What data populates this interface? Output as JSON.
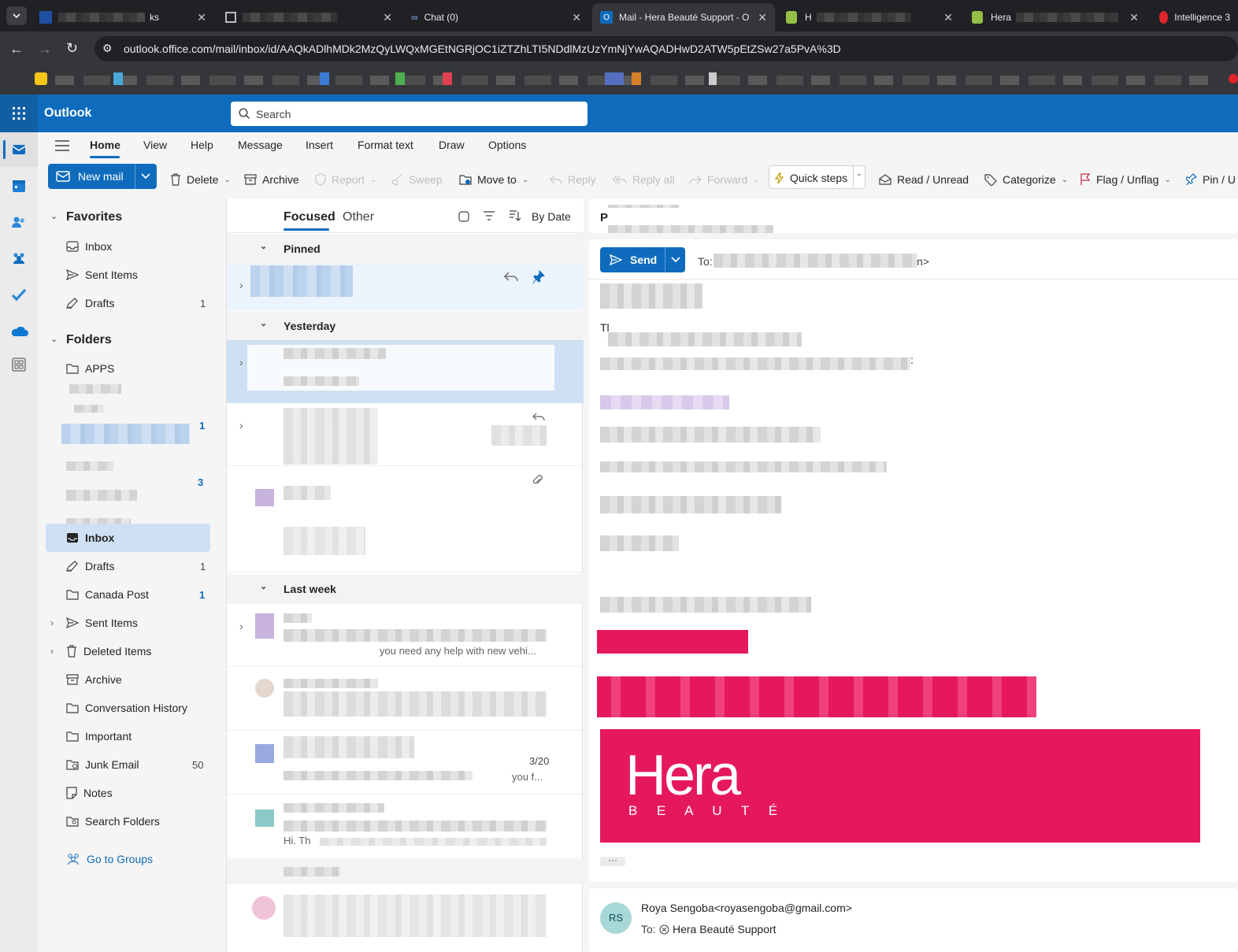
{
  "browser": {
    "tabs": [
      {
        "label": "ks",
        "active": false
      },
      {
        "label": "",
        "active": false
      },
      {
        "label": "Chat (0)",
        "active": false
      },
      {
        "label": "Mail - Hera Beauté Support - O",
        "active": true
      },
      {
        "label": "H",
        "active": false
      },
      {
        "label": "Hera",
        "active": false
      },
      {
        "label": "Intelligence 3",
        "active": false
      }
    ],
    "url": "outlook.office.com/mail/inbox/id/AAQkADlhMDk2MzQyLWQxMGEtNGRjOC1iZTZhLTI5NDdlMzUzYmNjYwAQADHwD2ATW5pEtZSw27a5PvA%3D"
  },
  "header": {
    "app_name": "Outlook",
    "search_placeholder": "Search"
  },
  "ribbon": {
    "tabs": [
      "Home",
      "View",
      "Help",
      "Message",
      "Insert",
      "Format text",
      "Draw",
      "Options"
    ],
    "active_tab": "Home",
    "commands": {
      "new_mail": "New mail",
      "delete": "Delete",
      "archive": "Archive",
      "report": "Report",
      "sweep": "Sweep",
      "move_to": "Move to",
      "reply": "Reply",
      "reply_all": "Reply all",
      "forward": "Forward",
      "quick_steps": "Quick steps",
      "read_unread": "Read / Unread",
      "categorize": "Categorize",
      "flag_unflag": "Flag / Unflag",
      "pin": "Pin / U"
    }
  },
  "nav": {
    "favorites_label": "Favorites",
    "favorites": [
      {
        "label": "Inbox",
        "count": ""
      },
      {
        "label": "Sent Items",
        "count": ""
      },
      {
        "label": "Drafts",
        "count": "1"
      }
    ],
    "folders_label": "Folders",
    "folders_top": [
      {
        "label": "APPS",
        "count": ""
      }
    ],
    "hidden_counts": [
      "1",
      "3"
    ],
    "folders": [
      {
        "label": "Inbox",
        "count": "",
        "selected": true
      },
      {
        "label": "Drafts",
        "count": "1"
      },
      {
        "label": "Canada Post",
        "count": "1"
      },
      {
        "label": "Sent Items",
        "count": ""
      },
      {
        "label": "Deleted Items",
        "count": ""
      },
      {
        "label": "Archive",
        "count": ""
      },
      {
        "label": "Conversation History",
        "count": ""
      },
      {
        "label": "Important",
        "count": ""
      },
      {
        "label": "Junk Email",
        "count": "50"
      },
      {
        "label": "Notes",
        "count": ""
      },
      {
        "label": "Search Folders",
        "count": ""
      }
    ],
    "go_to_groups": "Go to Groups"
  },
  "message_list": {
    "tab_focused": "Focused",
    "tab_other": "Other",
    "sort_label": "By Date",
    "groups": {
      "pinned": "Pinned",
      "yesterday": "Yesterday",
      "last_week": "Last week"
    },
    "snippets": {
      "s1": "you need any help with new vehi...",
      "s2": "3/20",
      "s3": "you f...",
      "s4": "Hi. Th"
    }
  },
  "reading_pane": {
    "subject_initial": "P",
    "send_label": "Send",
    "to_label": "To:",
    "to_suffix": "n>",
    "body_initial": "Tl",
    "logo_text": "Hera",
    "logo_sub": "B E A U T É",
    "more_label": "···",
    "sender_initials": "RS",
    "sender_line": "Roya Sengoba<royasengoba@gmail.com>",
    "to_recipient_label": "To:",
    "to_recipient": "Hera Beauté Support",
    "brand_pink": "#e5185f"
  }
}
